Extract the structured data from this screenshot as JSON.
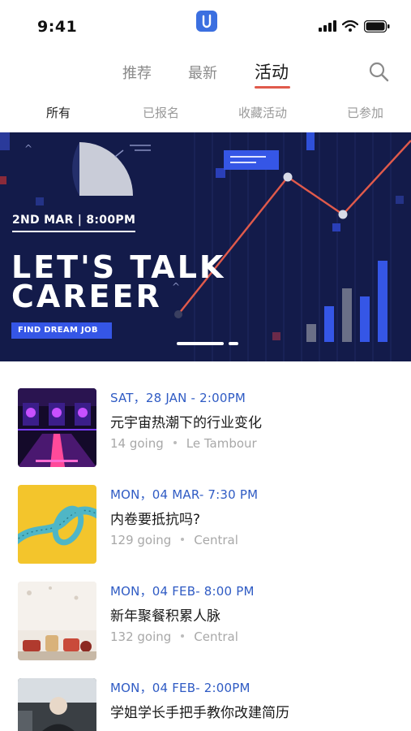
{
  "status_bar": {
    "time": "9:41"
  },
  "top_tabs": {
    "recommended": "推荐",
    "latest": "最新",
    "events": "活动"
  },
  "sub_tabs": {
    "all": "所有",
    "registered": "已报名",
    "favorites": "收藏活动",
    "joined": "已参加"
  },
  "banner": {
    "date": "2ND MAR | 8:00PM",
    "title_line1": "LET'S TALK",
    "title_line2": "CAREER",
    "cta": "FIND DREAM JOB",
    "pager_active_index": 0,
    "pager_count": 2
  },
  "events": [
    {
      "date": "SAT，28 JAN - 2:00PM",
      "title": "元宇宙热潮下的行业变化",
      "going": "14 going",
      "location": "Le Tambour",
      "thumb": "neon-stage"
    },
    {
      "date": "MON，04 MAR- 7:30 PM",
      "title": "内卷要抵抗吗?",
      "going": "129 going",
      "location": "Central",
      "thumb": "measuring-tape"
    },
    {
      "date": "MON，04 FEB- 8:00 PM",
      "title": "新年聚餐积累人脉",
      "going": "132 going",
      "location": "Central",
      "thumb": "dinner"
    },
    {
      "date": "MON，04 FEB- 2:00PM",
      "title": "学姐学长手把手教你改建简历",
      "going": "",
      "location": "",
      "thumb": "office"
    }
  ],
  "colors": {
    "accent": "#e05a4b",
    "brand": "#3b6fe0",
    "date_blue": "#2f5bc4",
    "banner_bg": "#131b4a"
  }
}
